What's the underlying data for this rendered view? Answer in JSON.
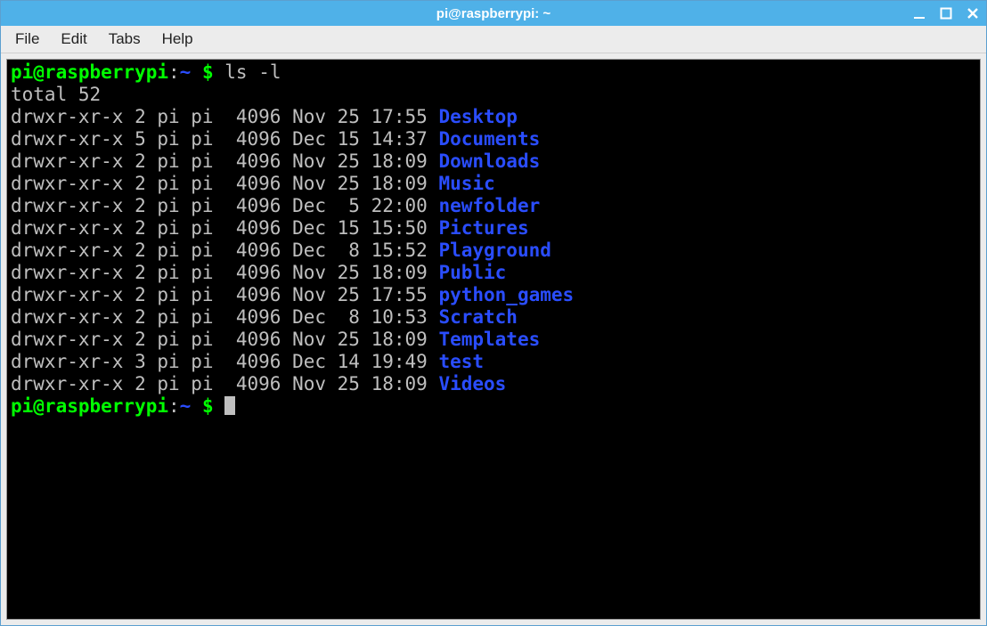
{
  "window": {
    "title": "pi@raspberrypi: ~"
  },
  "menu": {
    "file": "File",
    "edit": "Edit",
    "tabs": "Tabs",
    "help": "Help"
  },
  "prompt": {
    "userhost": "pi@raspberrypi",
    "sep": ":",
    "path": "~",
    "dollar": " $ "
  },
  "command": "ls -l",
  "total_line": "total 52",
  "listing": [
    {
      "perms": "drwxr-xr-x",
      "links": "2",
      "owner": "pi",
      "group": "pi",
      "size": "4096",
      "month": "Nov",
      "day": "25",
      "time": "17:55",
      "name": "Desktop"
    },
    {
      "perms": "drwxr-xr-x",
      "links": "5",
      "owner": "pi",
      "group": "pi",
      "size": "4096",
      "month": "Dec",
      "day": "15",
      "time": "14:37",
      "name": "Documents"
    },
    {
      "perms": "drwxr-xr-x",
      "links": "2",
      "owner": "pi",
      "group": "pi",
      "size": "4096",
      "month": "Nov",
      "day": "25",
      "time": "18:09",
      "name": "Downloads"
    },
    {
      "perms": "drwxr-xr-x",
      "links": "2",
      "owner": "pi",
      "group": "pi",
      "size": "4096",
      "month": "Nov",
      "day": "25",
      "time": "18:09",
      "name": "Music"
    },
    {
      "perms": "drwxr-xr-x",
      "links": "2",
      "owner": "pi",
      "group": "pi",
      "size": "4096",
      "month": "Dec",
      "day": " 5",
      "time": "22:00",
      "name": "newfolder"
    },
    {
      "perms": "drwxr-xr-x",
      "links": "2",
      "owner": "pi",
      "group": "pi",
      "size": "4096",
      "month": "Dec",
      "day": "15",
      "time": "15:50",
      "name": "Pictures"
    },
    {
      "perms": "drwxr-xr-x",
      "links": "2",
      "owner": "pi",
      "group": "pi",
      "size": "4096",
      "month": "Dec",
      "day": " 8",
      "time": "15:52",
      "name": "Playground"
    },
    {
      "perms": "drwxr-xr-x",
      "links": "2",
      "owner": "pi",
      "group": "pi",
      "size": "4096",
      "month": "Nov",
      "day": "25",
      "time": "18:09",
      "name": "Public"
    },
    {
      "perms": "drwxr-xr-x",
      "links": "2",
      "owner": "pi",
      "group": "pi",
      "size": "4096",
      "month": "Nov",
      "day": "25",
      "time": "17:55",
      "name": "python_games"
    },
    {
      "perms": "drwxr-xr-x",
      "links": "2",
      "owner": "pi",
      "group": "pi",
      "size": "4096",
      "month": "Dec",
      "day": " 8",
      "time": "10:53",
      "name": "Scratch"
    },
    {
      "perms": "drwxr-xr-x",
      "links": "2",
      "owner": "pi",
      "group": "pi",
      "size": "4096",
      "month": "Nov",
      "day": "25",
      "time": "18:09",
      "name": "Templates"
    },
    {
      "perms": "drwxr-xr-x",
      "links": "3",
      "owner": "pi",
      "group": "pi",
      "size": "4096",
      "month": "Dec",
      "day": "14",
      "time": "19:49",
      "name": "test"
    },
    {
      "perms": "drwxr-xr-x",
      "links": "2",
      "owner": "pi",
      "group": "pi",
      "size": "4096",
      "month": "Nov",
      "day": "25",
      "time": "18:09",
      "name": "Videos"
    }
  ]
}
